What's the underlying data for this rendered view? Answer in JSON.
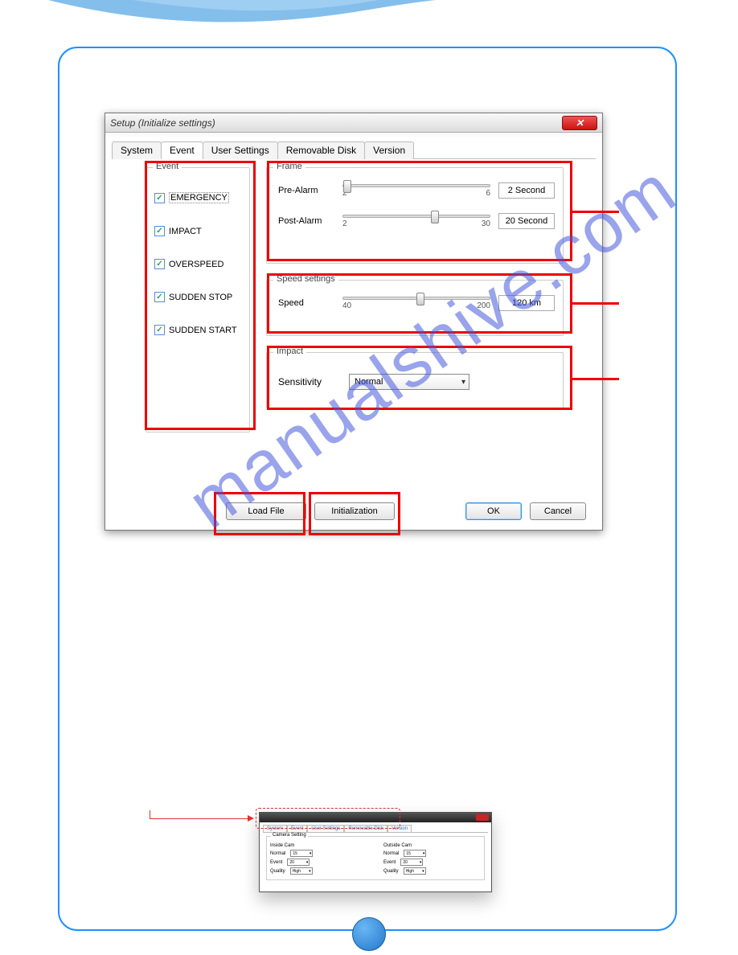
{
  "watermark": "manualshive.com",
  "dialog": {
    "title": "Setup (Initialize settings)",
    "tabs": [
      "System",
      "Event",
      "User Settings",
      "Removable Disk",
      "Version"
    ],
    "active_tab_index": 1,
    "event_group_label": "Event",
    "event_checks": [
      {
        "label": "EMERGENCY",
        "checked": true
      },
      {
        "label": "IMPACT",
        "checked": true
      },
      {
        "label": "OVERSPEED",
        "checked": true
      },
      {
        "label": "SUDDEN STOP",
        "checked": true
      },
      {
        "label": "SUDDEN START",
        "checked": true
      }
    ],
    "frame_group_label": "Frame",
    "frame": {
      "prealarm_label": "Pre-Alarm",
      "prealarm_min": "2",
      "prealarm_max": "6",
      "prealarm_value": "2 Second",
      "postalarm_label": "Post-Alarm",
      "postalarm_min": "2",
      "postalarm_max": "30",
      "postalarm_value": "20 Second"
    },
    "speed_group_label": "Speed settings",
    "speed": {
      "label": "Speed",
      "min": "40",
      "max": "200",
      "value": "120 km"
    },
    "impact_group_label": "Impact",
    "impact": {
      "label": "Sensitivity",
      "value": "Normal"
    },
    "buttons": {
      "load": "Load File",
      "init": "Initialization",
      "ok": "OK",
      "cancel": "Cancel"
    }
  },
  "mini": {
    "tabs": [
      "System",
      "Event",
      "User Settings",
      "Removable Disk",
      "Version"
    ],
    "camera_setting_label": "Camera Setting",
    "inside_label": "Inside Cam",
    "outside_label": "Outside Cam",
    "rows": [
      {
        "lbl": "Normal",
        "val": "15"
      },
      {
        "lbl": "Event",
        "val": "20"
      },
      {
        "lbl": "Quality",
        "val": "High"
      }
    ]
  }
}
